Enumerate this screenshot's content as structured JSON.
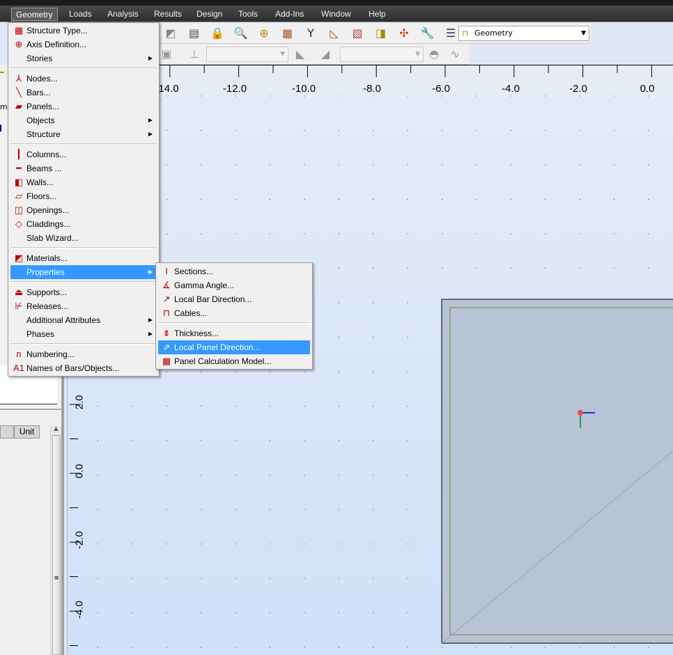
{
  "menubar": [
    {
      "label": "Geometry",
      "active": true
    },
    {
      "label": "Loads"
    },
    {
      "label": "Analysis"
    },
    {
      "label": "Results"
    },
    {
      "label": "Design"
    },
    {
      "label": "Tools"
    },
    {
      "label": "Add-Ins"
    },
    {
      "label": "Window"
    },
    {
      "label": "Help"
    }
  ],
  "toolbar": {
    "layout_combo": "Geometry",
    "layout_icon": "geometry-layout-icon",
    "icons": [
      "view-icon",
      "table-icon",
      "lock-icon",
      "zoom-icon",
      "pan-icon",
      "display-icon",
      "axes-icon",
      "measure-icon",
      "section-icon",
      "materials-icon",
      "render-icon",
      "tools-icon",
      "layout-list-icon"
    ]
  },
  "geometry_menu": [
    {
      "label": "Structure Type...",
      "icon": "structure-type-icon",
      "g": "▦"
    },
    {
      "label": "Axis Definition...",
      "icon": "axis-definition-icon",
      "g": "⊕"
    },
    {
      "label": "Stories",
      "sub": true
    },
    {
      "sep": true
    },
    {
      "label": "Nodes...",
      "icon": "nodes-icon",
      "g": "⅄"
    },
    {
      "label": "Bars...",
      "icon": "bars-icon",
      "g": "╲"
    },
    {
      "label": "Panels...",
      "icon": "panels-icon",
      "g": "▰"
    },
    {
      "label": "Objects",
      "sub": true
    },
    {
      "label": "Structure",
      "sub": true
    },
    {
      "sep": true
    },
    {
      "label": "Columns...",
      "icon": "columns-icon",
      "g": "┃"
    },
    {
      "label": "Beams ...",
      "icon": "beams-icon",
      "g": "━"
    },
    {
      "label": "Walls...",
      "icon": "walls-icon",
      "g": "◧"
    },
    {
      "label": "Floors...",
      "icon": "floors-icon",
      "g": "▱"
    },
    {
      "label": "Openings...",
      "icon": "openings-icon",
      "g": "◫"
    },
    {
      "label": "Claddings...",
      "icon": "claddings-icon",
      "g": "◇"
    },
    {
      "label": "Slab Wizard..."
    },
    {
      "sep": true
    },
    {
      "label": "Materials...",
      "icon": "materials-icon",
      "g": "◩"
    },
    {
      "label": "Properties",
      "sub": true,
      "highlighted": true
    },
    {
      "sep": true
    },
    {
      "label": "Supports...",
      "icon": "supports-icon",
      "g": "⏏"
    },
    {
      "label": "Releases...",
      "icon": "releases-icon",
      "g": "⊬"
    },
    {
      "label": "Additional Attributes",
      "sub": true
    },
    {
      "label": "Phases",
      "sub": true
    },
    {
      "sep": true
    },
    {
      "label": "Numbering...",
      "icon": "numbering-icon",
      "g": "n"
    },
    {
      "label": "Names of Bars/Objects...",
      "icon": "names-icon",
      "g": "A1"
    }
  ],
  "properties_menu": [
    {
      "label": "Sections...",
      "icon": "sections-icon",
      "g": "I"
    },
    {
      "label": "Gamma Angle...",
      "icon": "gamma-angle-icon",
      "g": "∡"
    },
    {
      "label": "Local Bar Direction...",
      "icon": "local-bar-direction-icon",
      "g": "↗"
    },
    {
      "label": "Cables...",
      "icon": "cables-icon",
      "g": "⊓"
    },
    {
      "sep": true
    },
    {
      "label": "Thickness...",
      "icon": "thickness-icon",
      "g": "⇟"
    },
    {
      "label": "Local Panel Direction...",
      "icon": "local-panel-direction-icon",
      "g": "⇗",
      "highlighted": true
    },
    {
      "label": "Panel Calculation Model...",
      "icon": "panel-calc-model-icon",
      "g": "▦"
    }
  ],
  "left_panel": {
    "clipped_label": "mb",
    "table_header_unit": "Unit"
  },
  "rulers": {
    "x_ticks": [
      "14.0",
      "-12.0",
      "-10.0",
      "-8.0",
      "-6.0",
      "-4.0",
      "-2.0",
      "0.0"
    ],
    "y_ticks": [
      "2.0",
      "0.0",
      "-2.0",
      "-4.0"
    ]
  },
  "colors": {
    "menu_highlight": "#3399ff",
    "panel_fill": "#b8c3d5",
    "panel_edge": "#7a8030",
    "canvas_bg": "#dbe6f7"
  }
}
